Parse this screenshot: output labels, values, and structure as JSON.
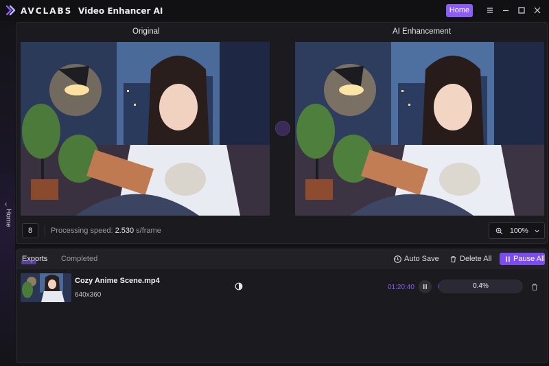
{
  "titlebar": {
    "brand": "AVCLABS",
    "app_name": "Video Enhancer AI",
    "home_button": "Home"
  },
  "side": {
    "home_label": "Home"
  },
  "preview": {
    "original_title": "Original",
    "enhanced_title": "AI Enhancement",
    "frame_value": "8",
    "speed_label": "Processing speed: ",
    "speed_value": "2.530",
    "speed_unit": " s/frame",
    "zoom_value": "100%"
  },
  "exports": {
    "tabs": [
      {
        "label": "Exports",
        "active": true
      },
      {
        "label": "Completed",
        "active": false
      }
    ],
    "auto_save_label": "Auto Save",
    "delete_all_label": "Delete All",
    "pause_all_label": "Pause All",
    "tasks": [
      {
        "filename": "Cozy Anime Scene.mp4",
        "resolution": "640x360",
        "time": "01:20:40",
        "progress_label": "0.4%",
        "progress": 0.004
      }
    ]
  },
  "colors": {
    "accent": "#8b5cf6",
    "background": "#131316",
    "panel": "#1b1b1f"
  },
  "icons": [
    "app-logo-icon",
    "menu-icon",
    "minimize-icon",
    "maximize-icon",
    "close-icon",
    "chevron-left-icon",
    "zoom-icon",
    "chevron-down-icon",
    "auto-save-icon",
    "trash-icon",
    "pause-icon",
    "compare-icon"
  ]
}
